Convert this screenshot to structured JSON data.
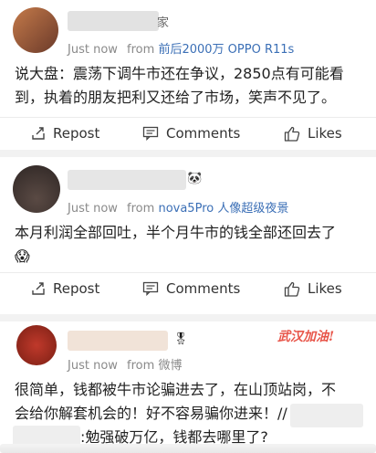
{
  "posts": [
    {
      "name_suffix": "家",
      "time": "Just now",
      "from_label": "from",
      "source": "前后2000万 OPPO R11s",
      "text": "说大盘：震荡下调牛市还在争议，2850点有可能看到，执着的朋友把利又还给了市场，笑声不见了。"
    },
    {
      "name_suffix": "🐼",
      "time": "Just now",
      "from_label": "from",
      "source": "nova5Pro 人像超级夜景",
      "text": "本月利润全部回吐，半个月牛市的钱全部还回去了",
      "emoji": "😱"
    },
    {
      "name_suffix": "🎖",
      "time": "Just now",
      "from_label": "from",
      "source": "微博",
      "tag": "武汉加油!",
      "text_line1": "很简单，钱都被牛市论骗进去了，在山顶站岗，不",
      "text_line2": "会给你解套机会的！好不容易骗你进来！//",
      "text_line3": ":勉强破万亿，钱都去哪里了?"
    }
  ],
  "actions": {
    "repost": "Repost",
    "comments": "Comments",
    "likes": "Likes"
  }
}
